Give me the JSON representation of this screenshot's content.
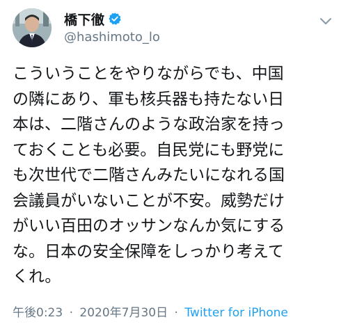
{
  "author": {
    "display_name": "橋下徹",
    "handle": "@hashimoto_lo",
    "verified_badge_color": "#1da1f2"
  },
  "icons": {
    "avatar": "profile-photo",
    "verified": "verified-badge-icon",
    "more": "chevron-down-icon"
  },
  "tweet": {
    "lines": [
      "こういうことをやりながらでも、中国",
      "の隣にあり、軍も核兵器も持たない日",
      "本は、二階さんのような政治家を持っ",
      "ておくことも必要。自民党にも野党に",
      "も次世代で二階さんみたいになれる国",
      "会議員がいないことが不安。威勢だけ",
      "がいい百田のオッサンなんか気にする",
      "な。日本の安全保障をしっかり考えて",
      "くれ。"
    ]
  },
  "meta": {
    "time": "午後0:23",
    "separator": "·",
    "date": "2020年7月30日",
    "source": "Twitter for iPhone"
  },
  "colors": {
    "text": "#14171a",
    "secondary": "#657786",
    "link": "#1da1f2"
  }
}
